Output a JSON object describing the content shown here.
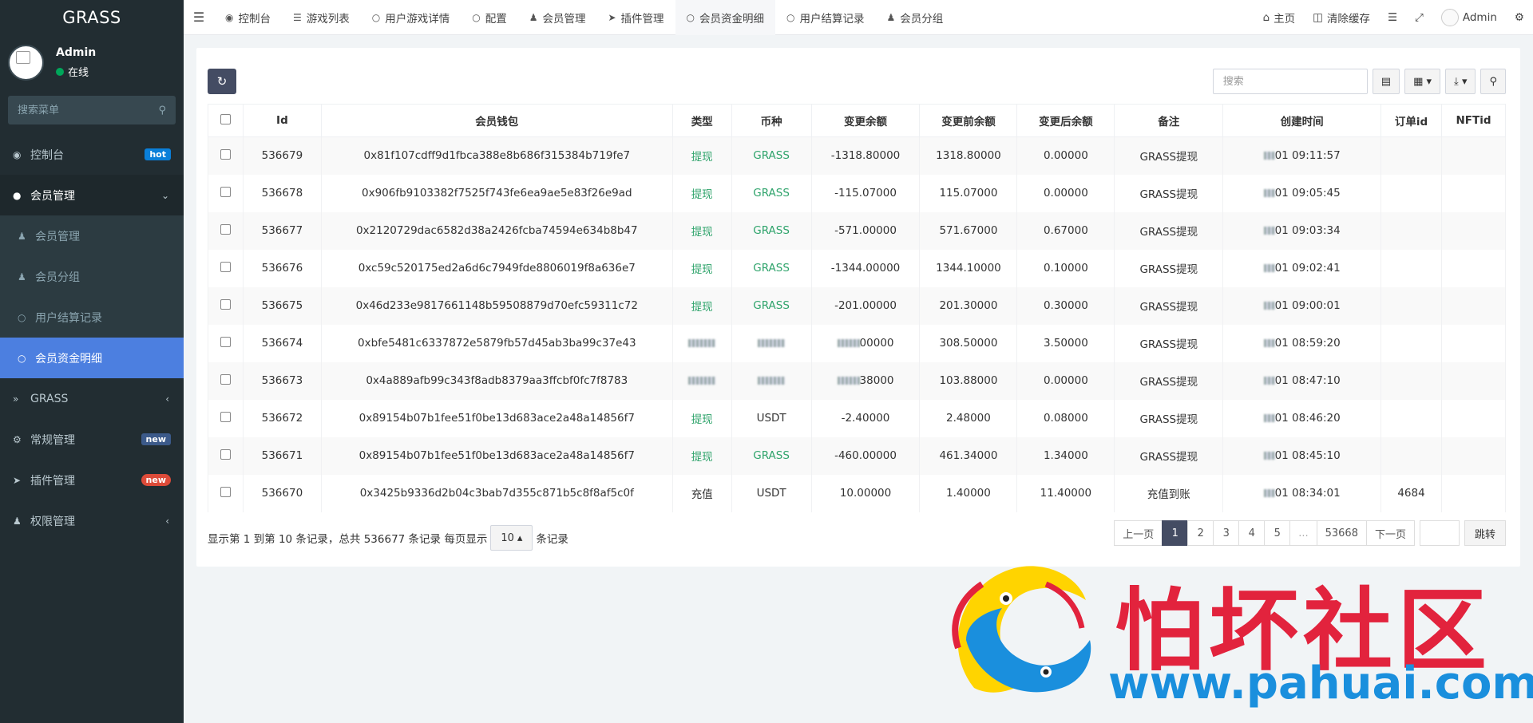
{
  "app": {
    "title": "GRASS"
  },
  "user": {
    "name": "Admin",
    "status": "在线"
  },
  "sidebar": {
    "search_placeholder": "搜索菜单",
    "items": [
      {
        "label": "控制台",
        "badge": "hot"
      },
      {
        "label": "会员管理"
      },
      {
        "label": "会员管理"
      },
      {
        "label": "会员分组"
      },
      {
        "label": "用户结算记录"
      },
      {
        "label": "会员资金明细"
      },
      {
        "label": "GRASS"
      },
      {
        "label": "常规管理",
        "badge": "new"
      },
      {
        "label": "插件管理",
        "badge": "new"
      },
      {
        "label": "权限管理"
      }
    ]
  },
  "topnav": {
    "tabs": [
      "控制台",
      "游戏列表",
      "用户游戏详情",
      "配置",
      "会员管理",
      "插件管理",
      "会员资金明细",
      "用户结算记录",
      "会员分组"
    ],
    "home": "主页",
    "clear_cache": "清除缓存",
    "user": "Admin"
  },
  "toolbar": {
    "search_placeholder": "搜索"
  },
  "table": {
    "headers": [
      "Id",
      "会员钱包",
      "类型",
      "币种",
      "变更余额",
      "变更前余额",
      "变更后余额",
      "备注",
      "创建时间",
      "订单id",
      "NFTid"
    ],
    "rows": [
      {
        "id": "536679",
        "wallet": "0x81f107cdff9d1fbca388e8b686f315384b719fe7",
        "type": "提现",
        "coin": "GRASS",
        "change": "-1318.80000",
        "before": "1318.80000",
        "after": "0.00000",
        "note": "GRASS提现",
        "time": "01 09:11:57",
        "order": "",
        "nft": ""
      },
      {
        "id": "536678",
        "wallet": "0x906fb9103382f7525f743fe6ea9ae5e83f26e9ad",
        "type": "提现",
        "coin": "GRASS",
        "change": "-115.07000",
        "before": "115.07000",
        "after": "0.00000",
        "note": "GRASS提现",
        "time": "01 09:05:45",
        "order": "",
        "nft": ""
      },
      {
        "id": "536677",
        "wallet": "0x2120729dac6582d38a2426fcba74594e634b8b47",
        "type": "提现",
        "coin": "GRASS",
        "change": "-571.00000",
        "before": "571.67000",
        "after": "0.67000",
        "note": "GRASS提现",
        "time": "01 09:03:34",
        "order": "",
        "nft": ""
      },
      {
        "id": "536676",
        "wallet": "0xc59c520175ed2a6d6c7949fde8806019f8a636e7",
        "type": "提现",
        "coin": "GRASS",
        "change": "-1344.00000",
        "before": "1344.10000",
        "after": "0.10000",
        "note": "GRASS提现",
        "time": "01 09:02:41",
        "order": "",
        "nft": ""
      },
      {
        "id": "536675",
        "wallet": "0x46d233e9817661148b59508879d70efc59311c72",
        "type": "提现",
        "coin": "GRASS",
        "change": "-201.00000",
        "before": "201.30000",
        "after": "0.30000",
        "note": "GRASS提现",
        "time": "01 09:00:01",
        "order": "",
        "nft": ""
      },
      {
        "id": "536674",
        "wallet": "0xbfe5481c6337872e5879fb57d45ab3ba99c37e43",
        "type": "",
        "coin": "",
        "change": "00000",
        "before": "308.50000",
        "after": "3.50000",
        "note": "GRASS提现",
        "time": "01 08:59:20",
        "order": "",
        "nft": ""
      },
      {
        "id": "536673",
        "wallet": "0x4a889afb99c343f8adb8379aa3ffcbf0fc7f8783",
        "type": "",
        "coin": "",
        "change": "38000",
        "before": "103.88000",
        "after": "0.00000",
        "note": "GRASS提现",
        "time": "01 08:47:10",
        "order": "",
        "nft": ""
      },
      {
        "id": "536672",
        "wallet": "0x89154b07b1fee51f0be13d683ace2a48a14856f7",
        "type": "提现",
        "coin": "USDT",
        "change": "-2.40000",
        "before": "2.48000",
        "after": "0.08000",
        "note": "GRASS提现",
        "time": "01 08:46:20",
        "order": "",
        "nft": ""
      },
      {
        "id": "536671",
        "wallet": "0x89154b07b1fee51f0be13d683ace2a48a14856f7",
        "type": "提现",
        "coin": "GRASS",
        "change": "-460.00000",
        "before": "461.34000",
        "after": "1.34000",
        "note": "GRASS提现",
        "time": "01 08:45:10",
        "order": "",
        "nft": ""
      },
      {
        "id": "536670",
        "wallet": "0x3425b9336d2b04c3bab7d355c871b5c8f8af5c0f",
        "type": "充值",
        "coin": "USDT",
        "change": "10.00000",
        "before": "1.40000",
        "after": "11.40000",
        "note": "充值到账",
        "time": "01 08:34:01",
        "order": "4684",
        "nft": ""
      }
    ]
  },
  "footer": {
    "info_prefix": "显示第 1 到第 10 条记录，总共 536677 条记录 每页显示",
    "page_size": "10",
    "info_suffix": "条记录"
  },
  "pager": {
    "prev": "上一页",
    "pages": [
      "1",
      "2",
      "3",
      "4",
      "5",
      "...",
      "53668"
    ],
    "next": "下一页",
    "jump": "跳转"
  },
  "watermark": {
    "text": "怕坏社区",
    "url": "www.pahuai.com"
  },
  "colors": {
    "sidebar": "#222d32",
    "active": "#4c7fe0",
    "green": "#30a46c",
    "primary_btn": "#444c63"
  }
}
